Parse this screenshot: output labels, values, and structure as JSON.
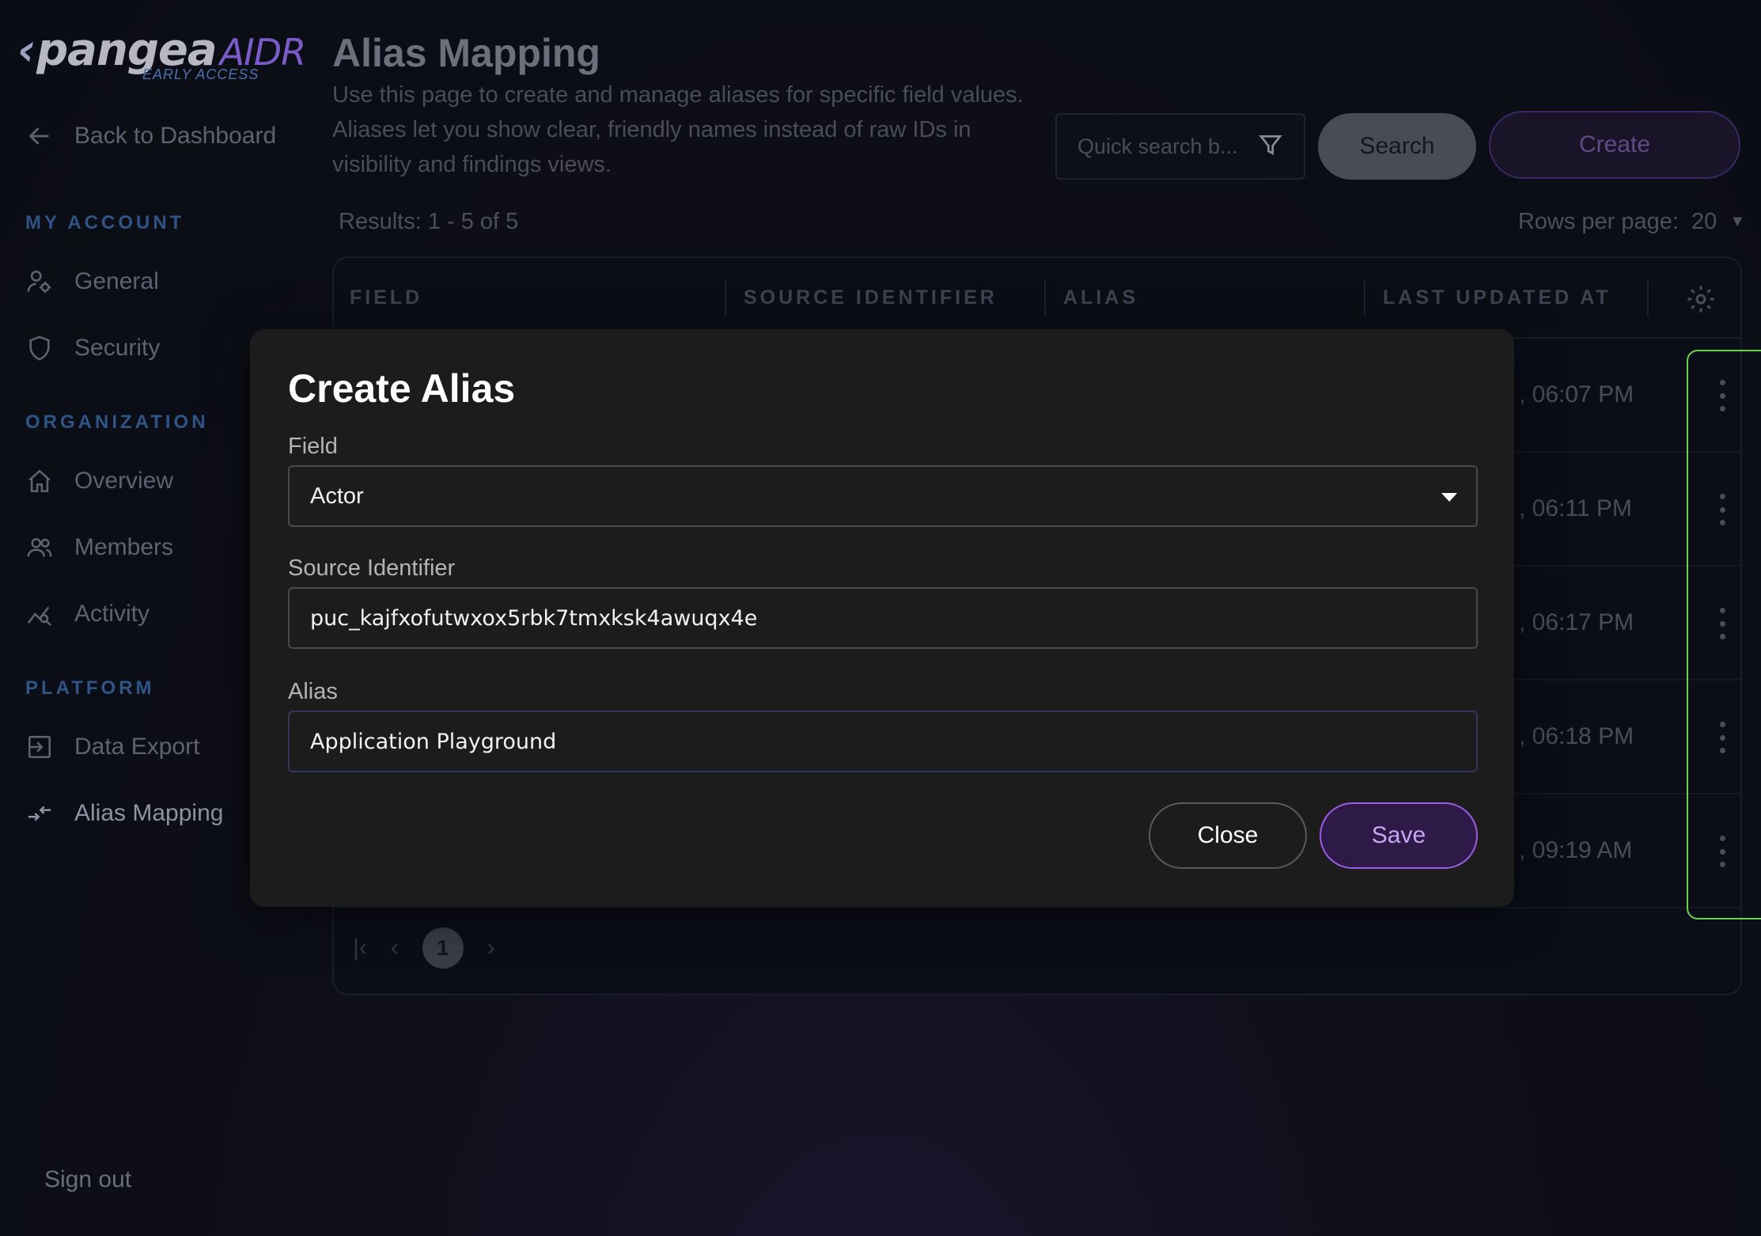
{
  "brand": {
    "name": "pangea",
    "product": "AIDR",
    "tag": "EARLY ACCESS"
  },
  "sidebar": {
    "back_label": "Back to Dashboard",
    "sections": [
      {
        "title": "MY ACCOUNT",
        "items": [
          {
            "label": "General",
            "icon": "user-gear-icon"
          },
          {
            "label": "Security",
            "icon": "shield-icon"
          }
        ]
      },
      {
        "title": "ORGANIZATION",
        "items": [
          {
            "label": "Overview",
            "icon": "home-icon"
          },
          {
            "label": "Members",
            "icon": "members-icon"
          },
          {
            "label": "Activity",
            "icon": "activity-icon"
          }
        ]
      },
      {
        "title": "PLATFORM",
        "items": [
          {
            "label": "Data Export",
            "icon": "export-icon"
          },
          {
            "label": "Alias Mapping",
            "icon": "alias-mapping-icon"
          }
        ]
      }
    ],
    "signout": "Sign out"
  },
  "main": {
    "title": "Alias Mapping",
    "description": "Use this page to create and manage aliases for specific field values. Aliases let you show clear, friendly names instead of raw IDs in visibility and findings views.",
    "search_placeholder": "Quick search b...",
    "search_button": "Search",
    "create_button": "Create",
    "results": "Results: 1 - 5 of 5",
    "rows_per_page_label": "Rows per page:",
    "rows_per_page_value": "20",
    "columns": [
      "FIELD",
      "SOURCE IDENTIFIER",
      "ALIAS",
      "LAST UPDATED AT"
    ],
    "rows": [
      {
        "time": ", 06:07 PM"
      },
      {
        "time": ", 06:11 PM"
      },
      {
        "time": ", 06:17 PM"
      },
      {
        "time": ", 06:18 PM"
      },
      {
        "time": ", 09:19 AM"
      }
    ],
    "current_page": "1"
  },
  "modal": {
    "title": "Create Alias",
    "field_label": "Field",
    "field_value": "Actor",
    "source_label": "Source Identifier",
    "source_value": "puc_kajfxofutwxox5rbk7tmxksk4awuqx4e",
    "alias_label": "Alias",
    "alias_value": "Application Playground",
    "close_button": "Close",
    "save_button": "Save"
  },
  "colors": {
    "accent": "#9b5de5",
    "highlight": "#6bd14f",
    "background": "#0c0e17"
  }
}
